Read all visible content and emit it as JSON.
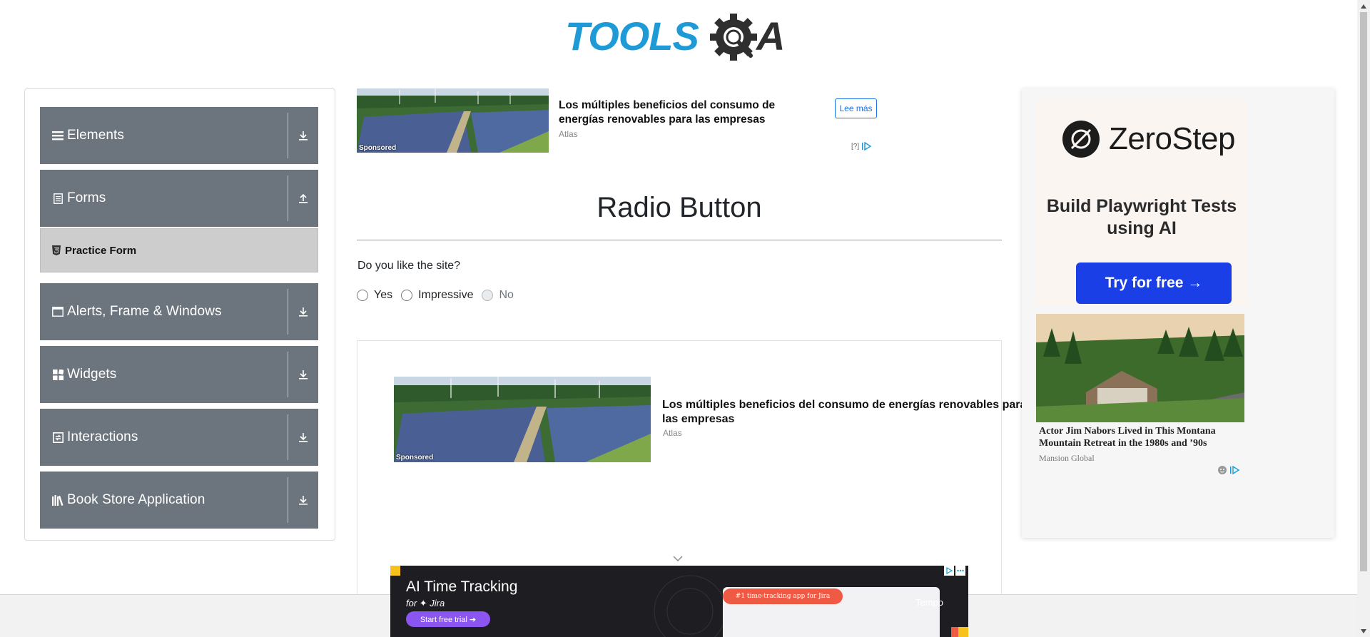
{
  "header": {
    "logo_text_left": "TOOLS",
    "logo_text_right": "A",
    "logo_colors": {
      "blue": "#1e9bd7",
      "dark": "#2f2f2f"
    }
  },
  "sidebar": {
    "colors": {
      "group_bg": "#6c757d",
      "submenu_bg": "#cdcdcd"
    },
    "groups": [
      {
        "label": "Elements",
        "icon": "menu-lines-icon",
        "arrow": "download-arrow-icon"
      },
      {
        "label": "Forms",
        "icon": "document-icon",
        "arrow": "upload-arrow-icon"
      },
      {
        "label": "Alerts, Frame & Windows",
        "icon": "window-icon",
        "arrow": "download-arrow-icon"
      },
      {
        "label": "Widgets",
        "icon": "widgets-grid-icon",
        "arrow": "download-arrow-icon"
      },
      {
        "label": "Interactions",
        "icon": "interactions-icon",
        "arrow": "download-arrow-icon"
      },
      {
        "label": "Book Store Application",
        "icon": "books-icon",
        "arrow": "download-arrow-icon"
      }
    ],
    "forms_submenu": [
      {
        "label": "Practice Form",
        "icon": "html5-icon"
      }
    ]
  },
  "ad_top": {
    "headline": "Los múltiples beneficios del consumo de energías renovables para las empresas",
    "source": "Atlas",
    "sponsored": "Sponsored",
    "cta": "Lee más",
    "adchoice": "[?]"
  },
  "main": {
    "title": "Radio Button",
    "question": "Do you like the site?",
    "radios": [
      {
        "label": "Yes",
        "disabled": false,
        "checked": false
      },
      {
        "label": "Impressive",
        "disabled": false,
        "checked": false
      },
      {
        "label": "No",
        "disabled": true,
        "checked": false
      }
    ]
  },
  "ad_mid": {
    "headline": "Los múltiples beneficios del consumo de energías renovables para las empresas",
    "source": "Atlas",
    "sponsored": "Sponsored"
  },
  "banner": {
    "title": "AI Time Tracking",
    "subtitle": "for ✦ Jira",
    "cta": "Start free trial ➔",
    "pill": "#1 time-tracking app for Jira",
    "brand": "Tempo",
    "colors": {
      "bg": "#1e1e22",
      "cta": "#8a55f0",
      "pill": "#ef5a45"
    }
  },
  "right_ad": {
    "brand": "ZeroStep",
    "tagline": "Build Playwright Tests using AI",
    "cta": "Try for free →",
    "story_headline": "Actor Jim Nabors Lived in This Montana Mountain Retreat in the 1980s and ’90s",
    "story_source": "Mansion Global",
    "colors": {
      "cta": "#1a3fe6"
    }
  }
}
